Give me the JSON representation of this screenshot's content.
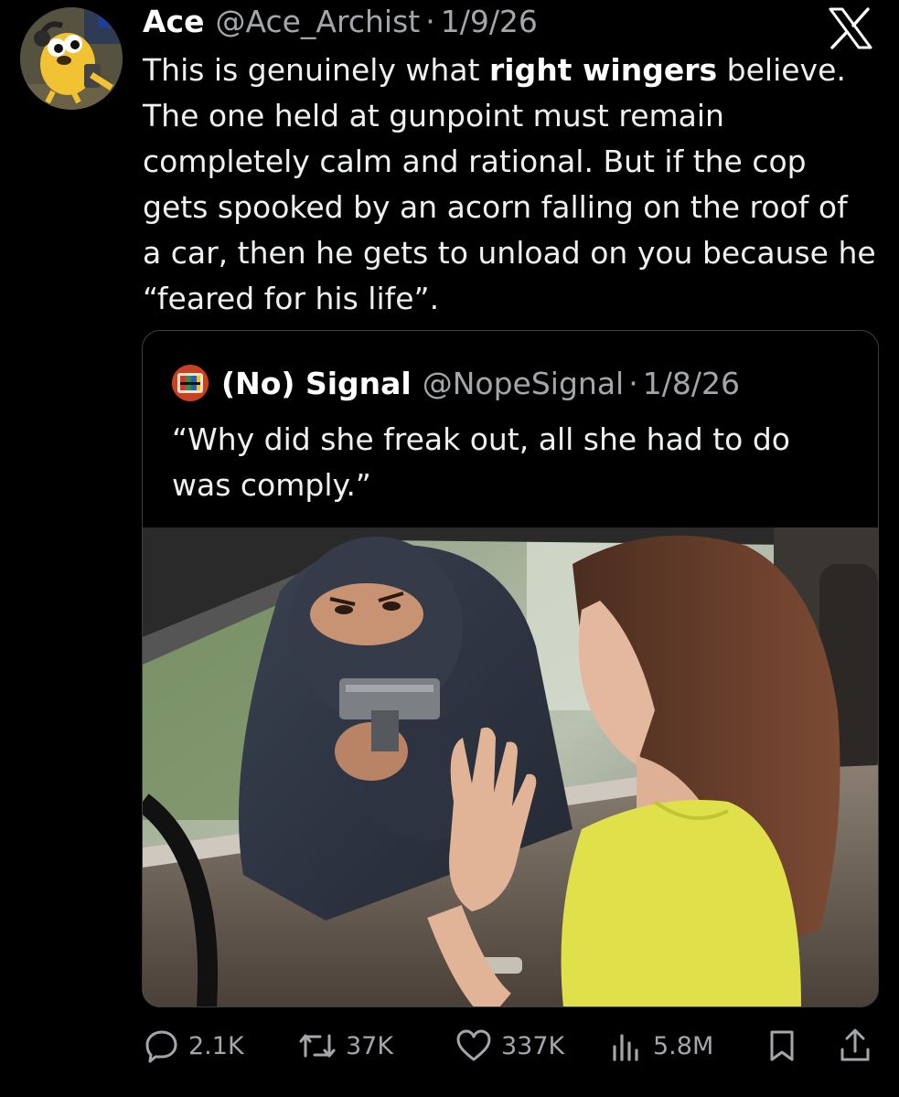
{
  "post": {
    "display_name": "Ace",
    "handle": "@Ace_Archist",
    "separator": "·",
    "date": "1/9/26",
    "text_before": "This is genuinely what ",
    "text_bold": "right wingers",
    "text_after": " believe.\nThe one held at gunpoint must remain\ncompletely calm and rational. But  if the cop\ngets spooked by an acorn falling on the roof of\na car, then he gets to unload on you because he\n“feared for his life”.",
    "platform_icon": "x-logo-icon",
    "avatar_icon": "cartoon-dog-avatar"
  },
  "quote": {
    "display_name": "(No) Signal",
    "handle": "@NopeSignal",
    "separator": "·",
    "date": "1/8/26",
    "text": "“Why did she freak out, all she had to do\nwas comply.”",
    "media_icon": "photo-masked-man-gun-at-car-window"
  },
  "actions": {
    "replies": {
      "icon": "reply-icon",
      "count": "2.1K"
    },
    "reposts": {
      "icon": "repost-icon",
      "count": "37K"
    },
    "likes": {
      "icon": "heart-icon",
      "count": "337K"
    },
    "views": {
      "icon": "views-icon",
      "count": "5.8M"
    },
    "bookmark": {
      "icon": "bookmark-icon"
    },
    "share": {
      "icon": "share-icon"
    }
  },
  "colors": {
    "background": "#000000",
    "text": "#e7e9ea",
    "muted": "#a3a6aa",
    "border": "#3a3d41"
  }
}
